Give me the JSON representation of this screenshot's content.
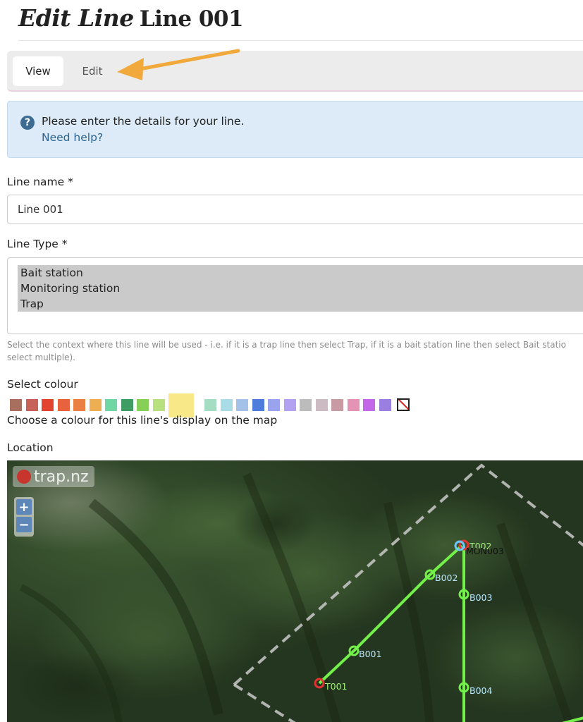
{
  "page": {
    "title_italic": "Edit Line",
    "title_name": "Line 001"
  },
  "tabs": [
    {
      "label": "View",
      "active": true
    },
    {
      "label": "Edit",
      "active": false
    }
  ],
  "info": {
    "icon": "question-circle-icon",
    "message": "Please enter the details for your line.",
    "help_link": "Need help?"
  },
  "form": {
    "line_name_label": "Line name *",
    "line_name_value": "Line 001",
    "line_type_label": "Line Type *",
    "line_type_options": [
      "Bait station",
      "Monitoring station",
      "Trap"
    ],
    "line_type_help_1": "Select the context where this line will be used - i.e. if it is a trap line then select Trap, if it is a bait station line then select Bait statio",
    "line_type_help_2": "select multiple).",
    "colour_label": "Select colour",
    "colour_help": "Choose a colour for this line's display on the map",
    "colours": [
      "#a86f5f",
      "#c86158",
      "#e2442f",
      "#e8623d",
      "#ea8043",
      "#eeae52",
      "#6fd6a4",
      "#3f9c63",
      "#86d05a",
      "#b9e07e",
      "#f8e887",
      "#a4dcc4",
      "#a8dce7",
      "#a4c2e7",
      "#4f7ddb",
      "#9aa3ee",
      "#b3a2f1",
      "#bcbcbc",
      "#cdbbc3",
      "#c89ba3",
      "#e593b5",
      "#c369e8",
      "#9a7fe0"
    ],
    "selected_colour": "#f8e887",
    "location_label": "Location"
  },
  "map": {
    "brand": "trap.nz",
    "zoom_in": "+",
    "zoom_out": "−",
    "markers": [
      {
        "label": "T001",
        "kind": "trap"
      },
      {
        "label": "B001",
        "kind": "bait"
      },
      {
        "label": "B002",
        "kind": "bait"
      },
      {
        "label": "T002",
        "kind": "trap"
      },
      {
        "label": "MON003",
        "kind": "monitor"
      },
      {
        "label": "B003",
        "kind": "bait"
      },
      {
        "label": "B004",
        "kind": "bait"
      }
    ],
    "line_colour": "#73f04a"
  }
}
